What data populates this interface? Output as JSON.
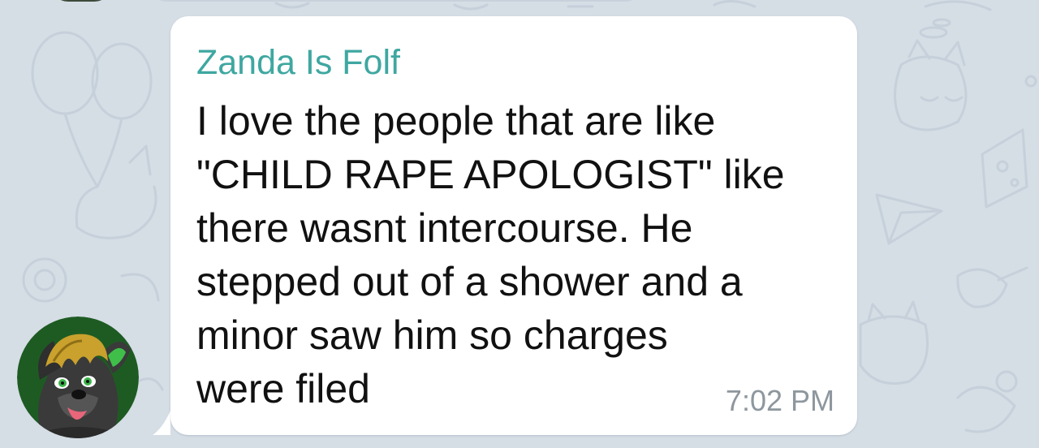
{
  "chat": {
    "message": {
      "sender": "Zanda Is Folf",
      "text_lines": [
        "I love the people that are like",
        "\"CHILD RAPE APOLOGIST\" like",
        "there wasnt intercourse. He",
        "stepped out of a shower and a",
        "minor saw him so charges",
        "were filed"
      ],
      "time": "7:02 PM"
    },
    "avatar": {
      "icon": "furry-wolf-avatar-icon"
    }
  },
  "colors": {
    "background": "#d5dde5",
    "bubble": "#ffffff",
    "sender_name": "#3fa7a1",
    "message_text": "#111111",
    "timestamp": "#8e979e",
    "avatar_background": "#1e5b23"
  }
}
